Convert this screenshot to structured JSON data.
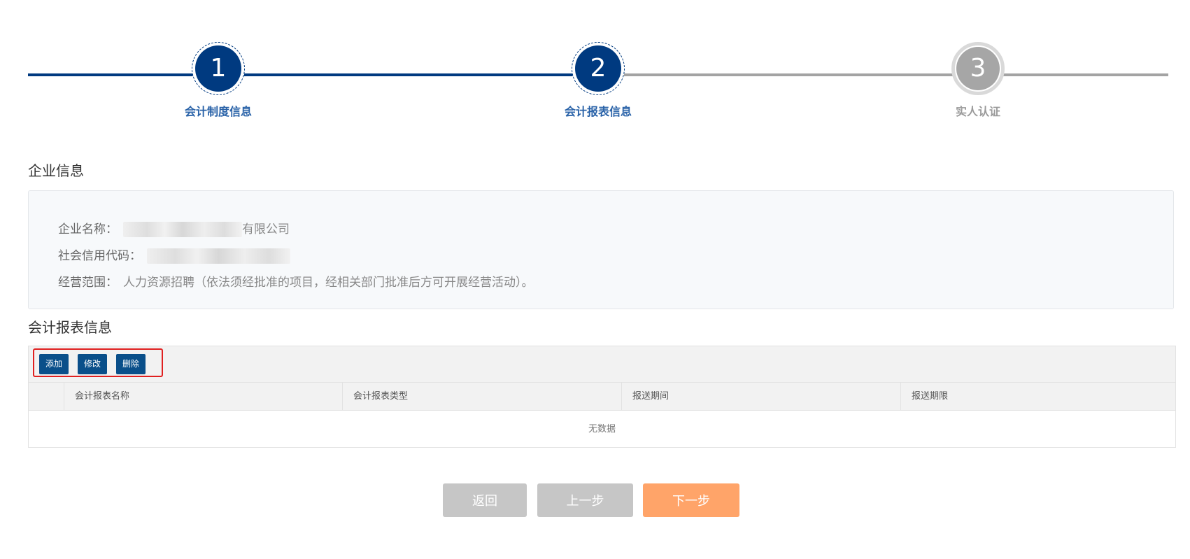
{
  "stepper": {
    "steps": [
      {
        "number": "1",
        "label": "会计制度信息",
        "state": "done"
      },
      {
        "number": "2",
        "label": "会计报表信息",
        "state": "active"
      },
      {
        "number": "3",
        "label": "实人认证",
        "state": "pending"
      }
    ]
  },
  "company_section": {
    "title": "企业信息",
    "fields": [
      {
        "label": "企业名称：",
        "value": "有限公司"
      },
      {
        "label": "社会信用代码：",
        "value": ""
      },
      {
        "label": "经营范围：",
        "value": "人力资源招聘（依法须经批准的项目，经相关部门批准后方可开展经营活动）。"
      }
    ]
  },
  "report_section": {
    "title": "会计报表信息",
    "toolbar": {
      "add_label": "添加",
      "edit_label": "修改",
      "delete_label": "删除"
    },
    "columns": [
      "会计报表名称",
      "会计报表类型",
      "报送期间",
      "报送期限"
    ],
    "rows": [],
    "empty_text": "无数据"
  },
  "actions": {
    "back_label": "返回",
    "prev_label": "上一步",
    "next_label": "下一步"
  },
  "colors": {
    "primary": "#003a80",
    "step_label": "#2962a8",
    "inactive": "#a6a6a6",
    "toolbar_button": "#0a4f8a",
    "highlight": "#e02020",
    "next_button": "#ffa469",
    "disabled_button": "#c6c6c6"
  }
}
